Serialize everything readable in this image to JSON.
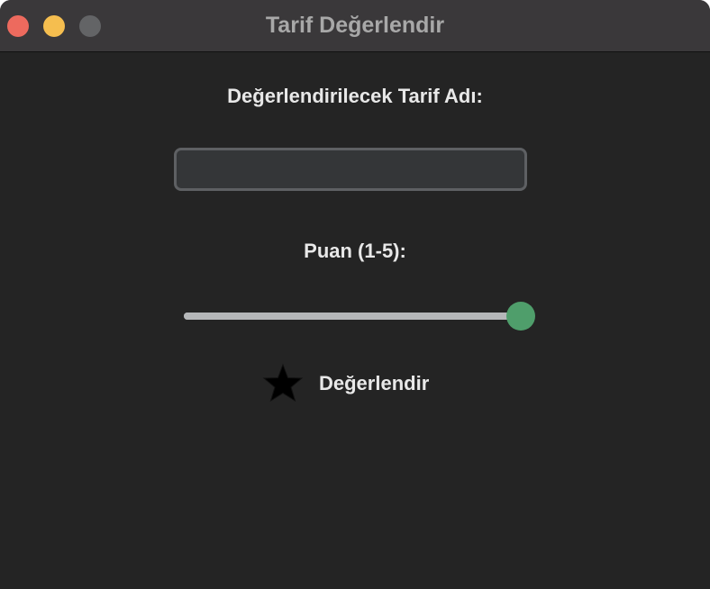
{
  "window": {
    "title": "Tarif Değerlendir",
    "traffic_lights": {
      "close_color": "#ed6a5e",
      "minimize_color": "#f5be4f",
      "zoom_color": "#636466"
    }
  },
  "form": {
    "recipe_label": "Değerlendirilecek Tarif Adı:",
    "recipe_input": {
      "value": "",
      "placeholder": ""
    },
    "score_label": "Puan (1-5):",
    "score_slider": {
      "min": 1,
      "max": 5,
      "value": 5,
      "accent_color": "#4f9e6b"
    },
    "rate_button": {
      "icon": "star-icon",
      "label": "Değerlendir"
    }
  }
}
